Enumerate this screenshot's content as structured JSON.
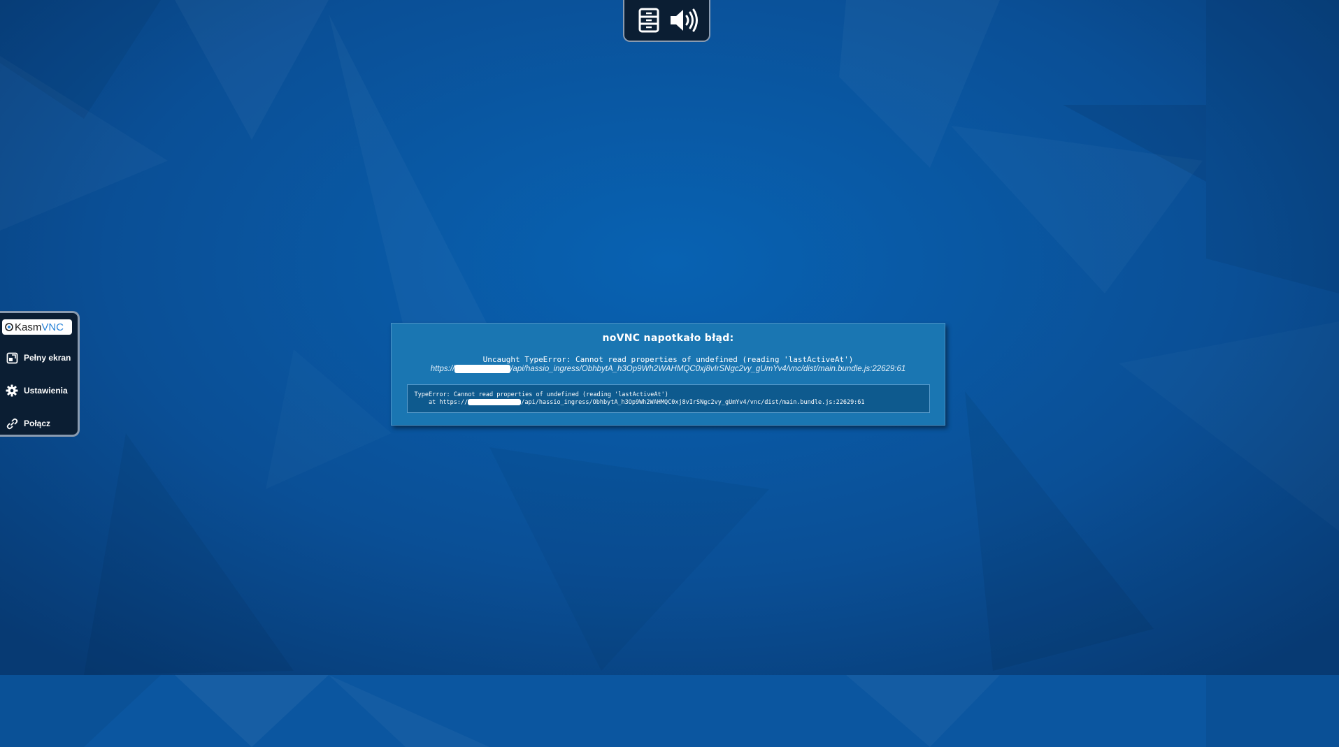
{
  "top_bar": {
    "icons": [
      "server-icon",
      "speaker-volume-icon"
    ]
  },
  "side_panel": {
    "logo": {
      "part1": "Kasm",
      "part2": "VNC"
    },
    "items": [
      {
        "label": "Pełny ekran",
        "icon": "fullscreen-icon"
      },
      {
        "label": "Ustawienia",
        "icon": "gear-icon"
      },
      {
        "label": "Połącz",
        "icon": "link-icon"
      }
    ]
  },
  "error": {
    "title": "noVNC napotkało błąd:",
    "message": "Uncaught TypeError: Cannot read properties of undefined (reading 'lastActiveAt')",
    "source_prefix": "https://",
    "source_suffix": "/api/hassio_ingress/ObhbytA_h3Op9Wh2WAHMQC0xj8vIrSNgc2vy_gUmYv4/vnc/dist/main.bundle.js:22629:61",
    "stack_line1": "TypeError: Cannot read properties of undefined (reading 'lastActiveAt')",
    "stack_line2_prefix": "    at https://",
    "stack_line2_suffix": "/api/hassio_ingress/ObhbytA_h3Op9Wh2WAHMQC0xj8vIrSNgc2vy_gUmYv4/vnc/dist/main.bundle.js:22629:61"
  },
  "colors": {
    "background": "#0a4f96",
    "dialog": "#1a76b2",
    "panel": "#0b1e33",
    "logo_accent": "#2a84d8"
  }
}
